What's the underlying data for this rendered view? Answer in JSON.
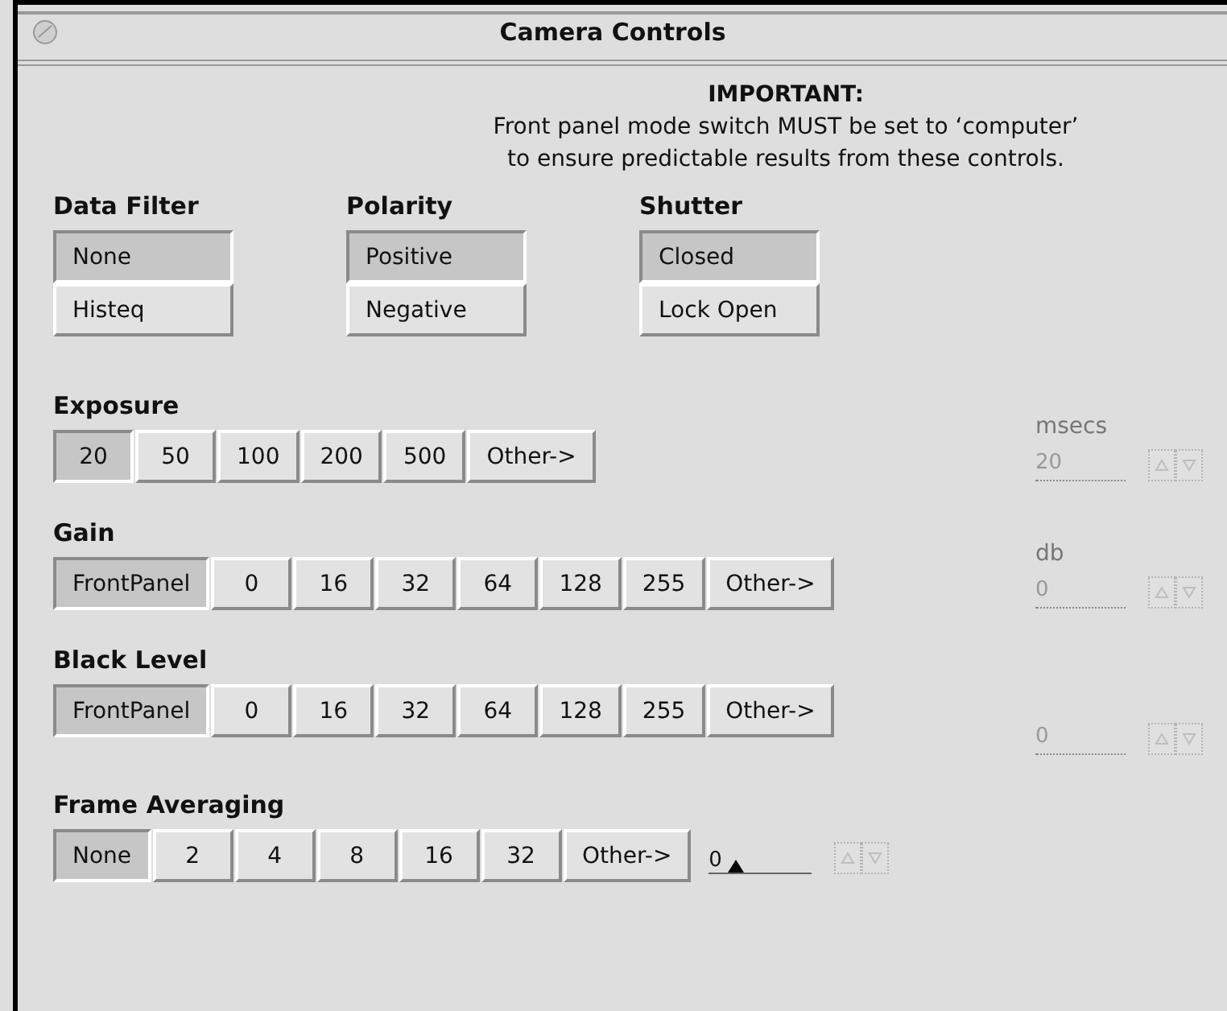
{
  "window": {
    "title": "Camera Controls"
  },
  "notice": {
    "heading": "IMPORTANT:",
    "lines": [
      "Front panel mode switch MUST be set to ‘computer’",
      "to ensure predictable results from these controls."
    ]
  },
  "toggle_groups": [
    {
      "label": "Data Filter",
      "options": [
        {
          "label": "None",
          "selected": true
        },
        {
          "label": "Histeq",
          "selected": false
        }
      ]
    },
    {
      "label": "Polarity",
      "options": [
        {
          "label": "Positive",
          "selected": true
        },
        {
          "label": "Negative",
          "selected": false
        }
      ]
    },
    {
      "label": "Shutter",
      "options": [
        {
          "label": "Closed",
          "selected": true
        },
        {
          "label": "Lock Open",
          "selected": false
        }
      ]
    }
  ],
  "sections": [
    {
      "label": "Exposure",
      "unit": "msecs",
      "options": [
        {
          "label": "20",
          "selected": true
        },
        {
          "label": "50",
          "selected": false
        },
        {
          "label": "100",
          "selected": false
        },
        {
          "label": "200",
          "selected": false
        },
        {
          "label": "500",
          "selected": false
        },
        {
          "label": "Other->",
          "selected": false
        }
      ],
      "field": {
        "kind": "text",
        "value": "20",
        "disabled": true
      }
    },
    {
      "label": "Gain",
      "unit": "db",
      "options": [
        {
          "label": "FrontPanel",
          "selected": true
        },
        {
          "label": "0",
          "selected": false
        },
        {
          "label": "16",
          "selected": false
        },
        {
          "label": "32",
          "selected": false
        },
        {
          "label": "64",
          "selected": false
        },
        {
          "label": "128",
          "selected": false
        },
        {
          "label": "255",
          "selected": false
        },
        {
          "label": "Other->",
          "selected": false
        }
      ],
      "field": {
        "kind": "text",
        "value": "0",
        "disabled": true
      }
    },
    {
      "label": "Black Level",
      "options": [
        {
          "label": "FrontPanel",
          "selected": true
        },
        {
          "label": "0",
          "selected": false
        },
        {
          "label": "16",
          "selected": false
        },
        {
          "label": "32",
          "selected": false
        },
        {
          "label": "64",
          "selected": false
        },
        {
          "label": "128",
          "selected": false
        },
        {
          "label": "255",
          "selected": false
        },
        {
          "label": "Other->",
          "selected": false
        }
      ],
      "field": {
        "kind": "text",
        "value": "0",
        "disabled": true
      }
    },
    {
      "label": "Frame Averaging",
      "options": [
        {
          "label": "None",
          "selected": true
        },
        {
          "label": "2",
          "selected": false
        },
        {
          "label": "4",
          "selected": false
        },
        {
          "label": "8",
          "selected": false
        },
        {
          "label": "16",
          "selected": false
        },
        {
          "label": "32",
          "selected": false
        },
        {
          "label": "Other->",
          "selected": false
        }
      ],
      "field": {
        "kind": "slider",
        "value": "0",
        "disabled": false
      }
    }
  ]
}
